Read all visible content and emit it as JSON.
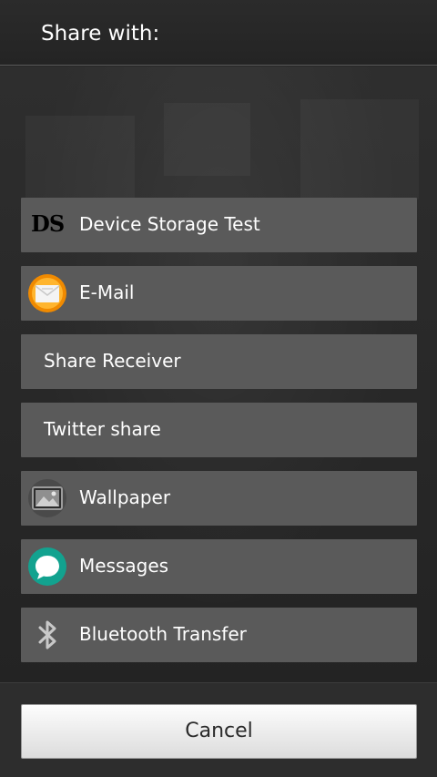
{
  "header": {
    "title": "Share with:"
  },
  "share_options": [
    {
      "label": "Device Storage Test",
      "icon": "device-storage-test-icon",
      "icon_text": "DS"
    },
    {
      "label": "E-Mail",
      "icon": "email-app-icon"
    },
    {
      "label": "Share Receiver",
      "icon": ""
    },
    {
      "label": "Twitter share",
      "icon": ""
    },
    {
      "label": "Wallpaper",
      "icon": "wallpaper-app-icon"
    },
    {
      "label": "Messages",
      "icon": "messages-app-icon"
    },
    {
      "label": "Bluetooth Transfer",
      "icon": "bluetooth-icon"
    }
  ],
  "footer": {
    "cancel_label": "Cancel"
  },
  "colors": {
    "row_background": "#5a5a5a",
    "email_icon_orange": "#f08a00",
    "messages_icon_teal": "#12a28f"
  }
}
